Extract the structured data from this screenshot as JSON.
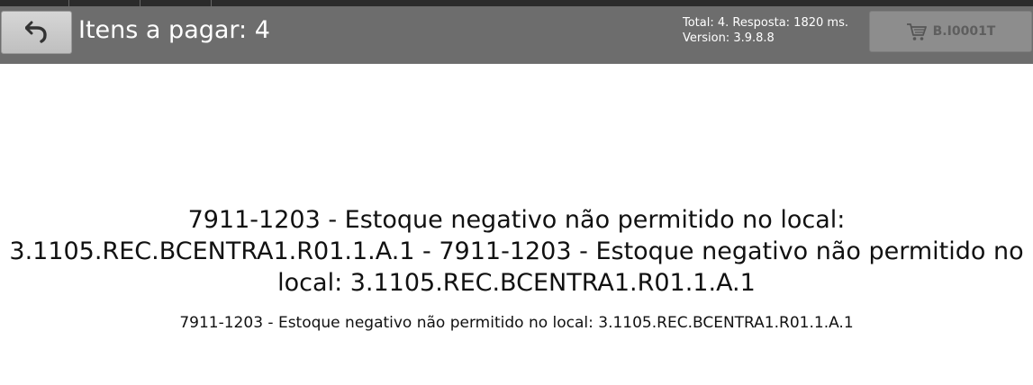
{
  "header": {
    "title": "Itens a pagar: 4",
    "total_line": "Total: 4. Resposta: 1820 ms.",
    "version_line": "Version: 3.9.8.8",
    "cart_label": "B.I0001T",
    "back_icon": "undo-arrow-icon",
    "cart_icon": "shopping-cart-icon"
  },
  "message": {
    "main": "7911-1203 - Estoque negativo não permitido no local: 3.1105.REC.BCENTRA1.R01.1.A.1 - 7911-1203 - Estoque negativo não permitido no local: 3.1105.REC.BCENTRA1.R01.1.A.1",
    "detail": "7911-1203 - Estoque negativo não permitido no local: 3.1105.REC.BCENTRA1.R01.1.A.1"
  },
  "colors": {
    "header_bg": "#6d6d6d",
    "button_bg": "#d6d6d6",
    "cart_button_bg": "#8d8d8d",
    "text": "#111111"
  }
}
